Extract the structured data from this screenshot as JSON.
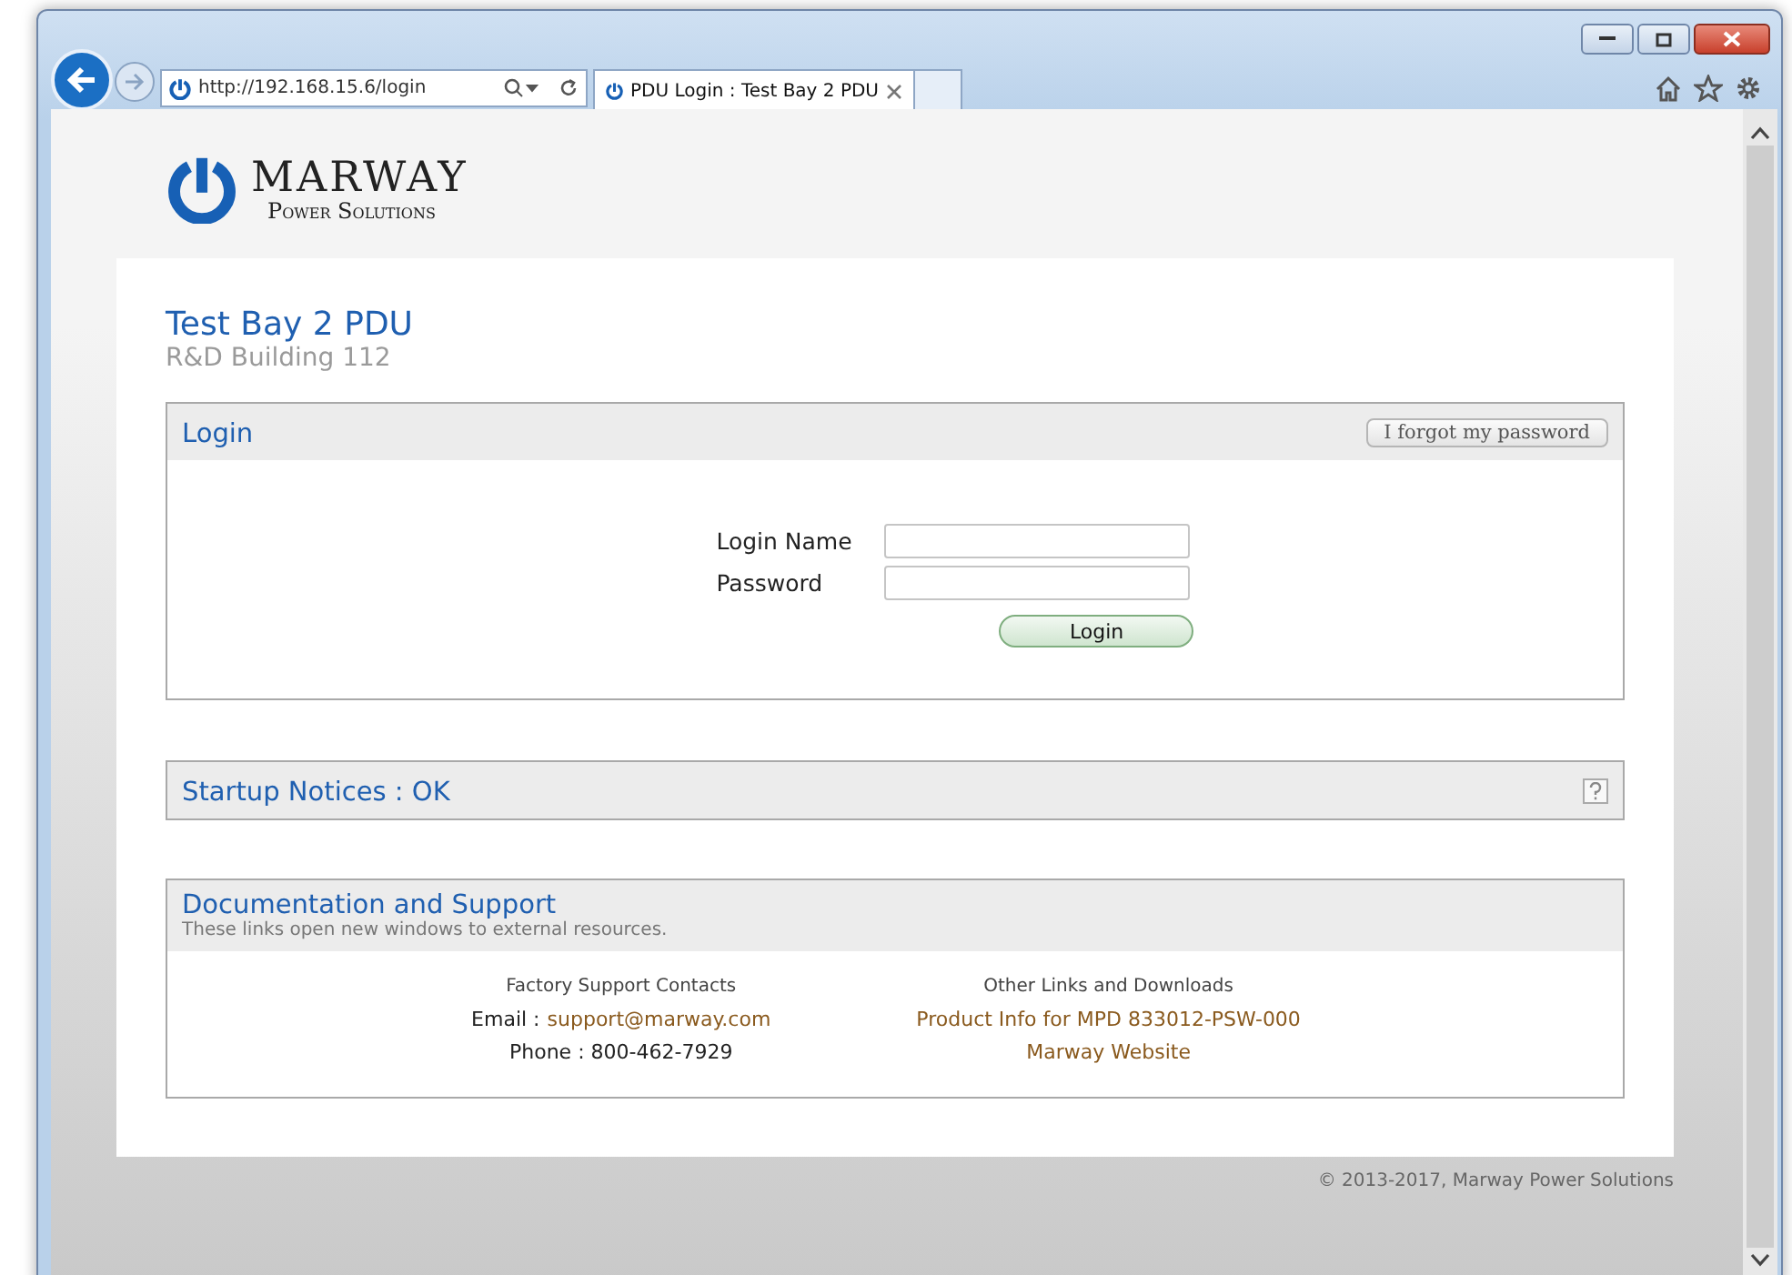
{
  "browser": {
    "address": "http://192.168.15.6/login",
    "tabs": [
      {
        "title": "PDU Login : Test Bay 2 PDU",
        "selected": true
      }
    ]
  },
  "logo": {
    "name": "MARWAY",
    "tagline": "Power Solutions"
  },
  "device": {
    "name": "Test Bay 2 PDU",
    "location": "R&D Building 112"
  },
  "login": {
    "title": "Login",
    "forgot_button": "I forgot my password",
    "fields": [
      {
        "label": "Login Name"
      },
      {
        "label": "Password"
      }
    ],
    "submit": "Login"
  },
  "notices": {
    "title": "Startup Notices : OK"
  },
  "docs": {
    "title": "Documentation and Support",
    "subtitle": "These links open new windows to external resources.",
    "columns": [
      {
        "heading": "Factory Support Contacts",
        "lines": [
          {
            "label": "Email :",
            "link": "support@marway.com"
          },
          {
            "label": "Phone : 800-462-7929"
          }
        ]
      },
      {
        "heading": "Other Links and Downloads",
        "lines": [
          {
            "link": "Product Info for MPD 833012-PSW-000"
          },
          {
            "link": "Marway Website"
          }
        ]
      }
    ]
  },
  "footer": {
    "copyright": "© 2013-2017, Marway Power Solutions"
  }
}
